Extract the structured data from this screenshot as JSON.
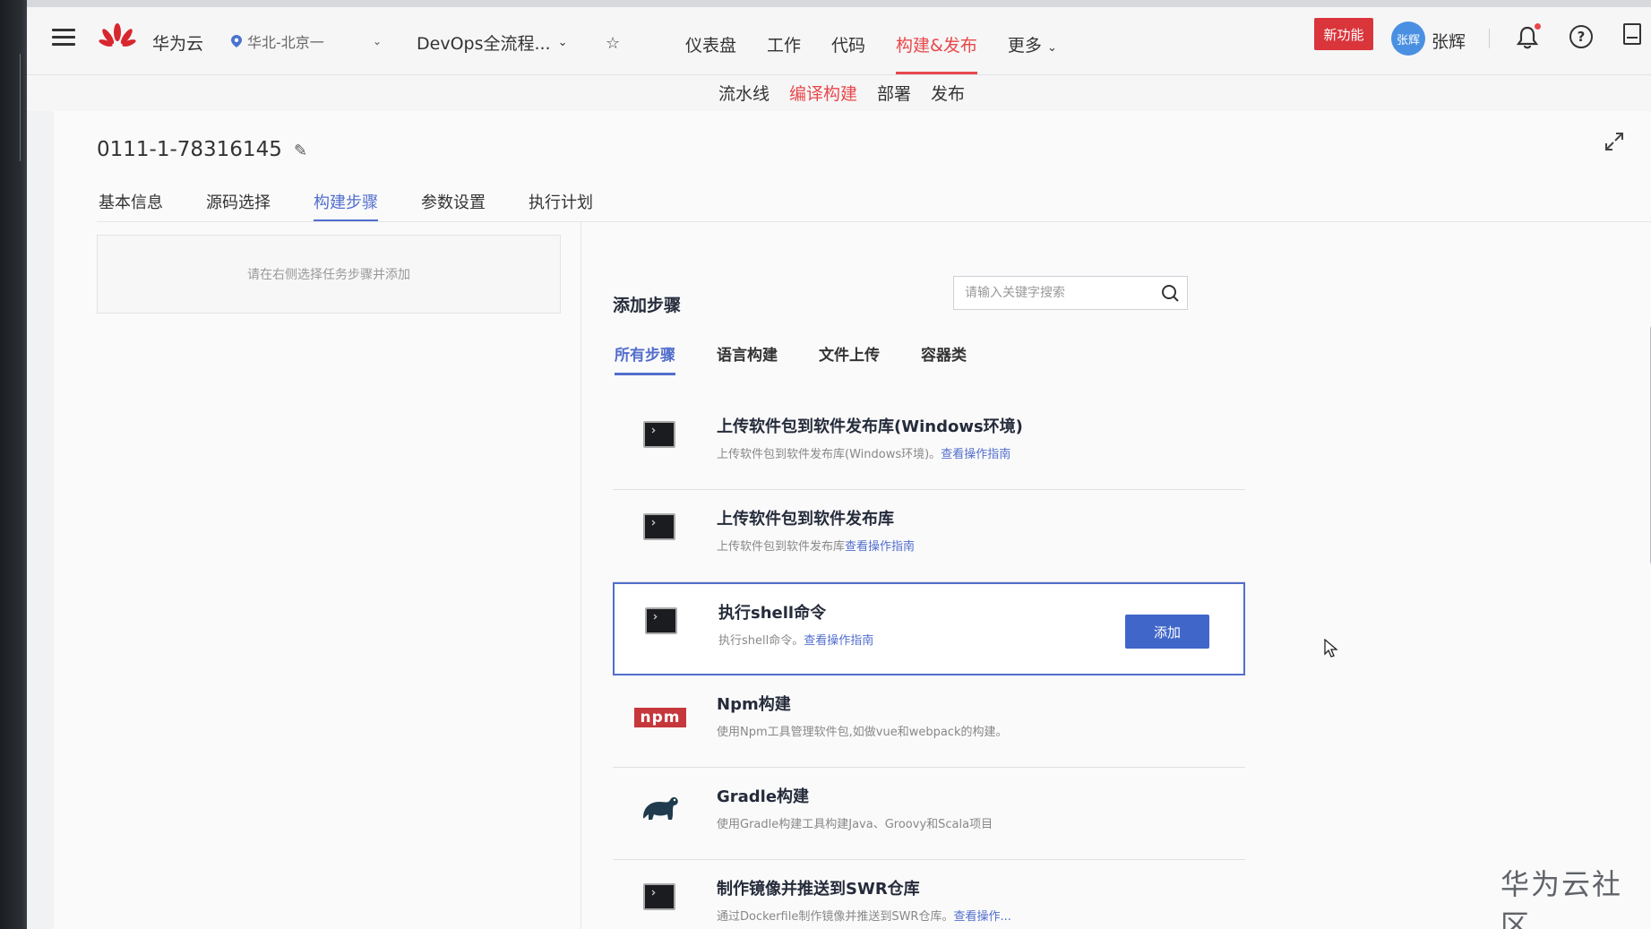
{
  "header": {
    "brand": "华为云",
    "region": "华北-北京一",
    "project": "DevOps全流程...",
    "nav": [
      {
        "label": "仪表盘"
      },
      {
        "label": "工作"
      },
      {
        "label": "代码"
      },
      {
        "label": "构建&发布",
        "active": true
      },
      {
        "label": "更多"
      }
    ],
    "new_badge": "新功能",
    "avatar_text": "张辉",
    "username": "张辉"
  },
  "subnav": [
    {
      "label": "流水线"
    },
    {
      "label": "编译构建",
      "active": true
    },
    {
      "label": "部署"
    },
    {
      "label": "发布"
    }
  ],
  "page": {
    "title": "0111-1-78316145",
    "tabs": [
      {
        "label": "基本信息"
      },
      {
        "label": "源码选择"
      },
      {
        "label": "构建步骤",
        "active": true
      },
      {
        "label": "参数设置"
      },
      {
        "label": "执行计划"
      }
    ],
    "left_hint": "请在右侧选择任务步骤并添加"
  },
  "add_steps": {
    "title": "添加步骤",
    "search_placeholder": "请输入关键字搜索",
    "tabs": [
      {
        "label": "所有步骤",
        "active": true
      },
      {
        "label": "语言构建"
      },
      {
        "label": "文件上传"
      },
      {
        "label": "容器类"
      }
    ],
    "add_button": "添加",
    "items": [
      {
        "name": "上传软件包到软件发布库(Windows环境)",
        "desc": "上传软件包到软件发布库(Windows环境)。",
        "link": "查看操作指南",
        "icon": "terminal-icon"
      },
      {
        "name": "上传软件包到软件发布库",
        "desc": "上传软件包到软件发布库",
        "link": "查看操作指南",
        "icon": "terminal-icon"
      },
      {
        "name": "执行shell命令",
        "desc": "执行shell命令。",
        "link": "查看操作指南",
        "icon": "terminal-icon",
        "selected": true
      },
      {
        "name": "Npm构建",
        "desc": "使用Npm工具管理软件包,如做vue和webpack的构建。",
        "link": "",
        "icon": "npm-icon"
      },
      {
        "name": "Gradle构建",
        "desc": "使用Gradle构建工具构建Java、Groovy和Scala项目",
        "link": "",
        "icon": "gradle-icon"
      },
      {
        "name": "制作镜像并推送到SWR仓库",
        "desc": "通过Dockerfile制作镜像并推送到SWR仓库。",
        "link": "查看操作...",
        "icon": "terminal-icon"
      }
    ]
  },
  "watermark": "华为云社区",
  "colors": {
    "accent_red": "#e8484b",
    "accent_blue": "#526ecc",
    "button_blue": "#4066c9"
  }
}
